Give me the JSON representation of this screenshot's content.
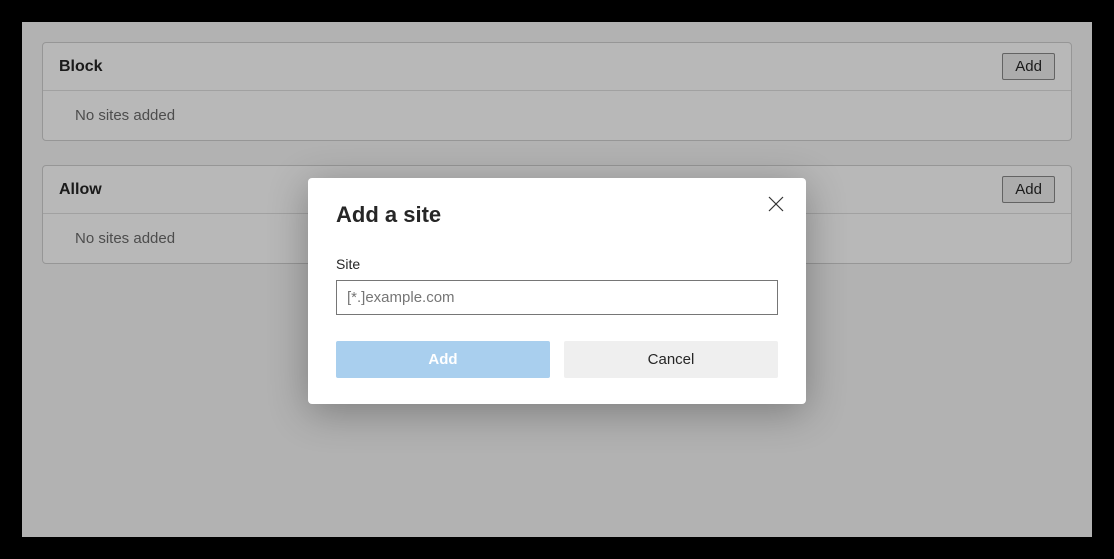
{
  "sections": {
    "block": {
      "title": "Block",
      "add_label": "Add",
      "empty_text": "No sites added"
    },
    "allow": {
      "title": "Allow",
      "add_label": "Add",
      "empty_text": "No sites added"
    }
  },
  "dialog": {
    "title": "Add a site",
    "field_label": "Site",
    "input_value": "",
    "input_placeholder": "[*.]example.com",
    "add_label": "Add",
    "cancel_label": "Cancel"
  }
}
